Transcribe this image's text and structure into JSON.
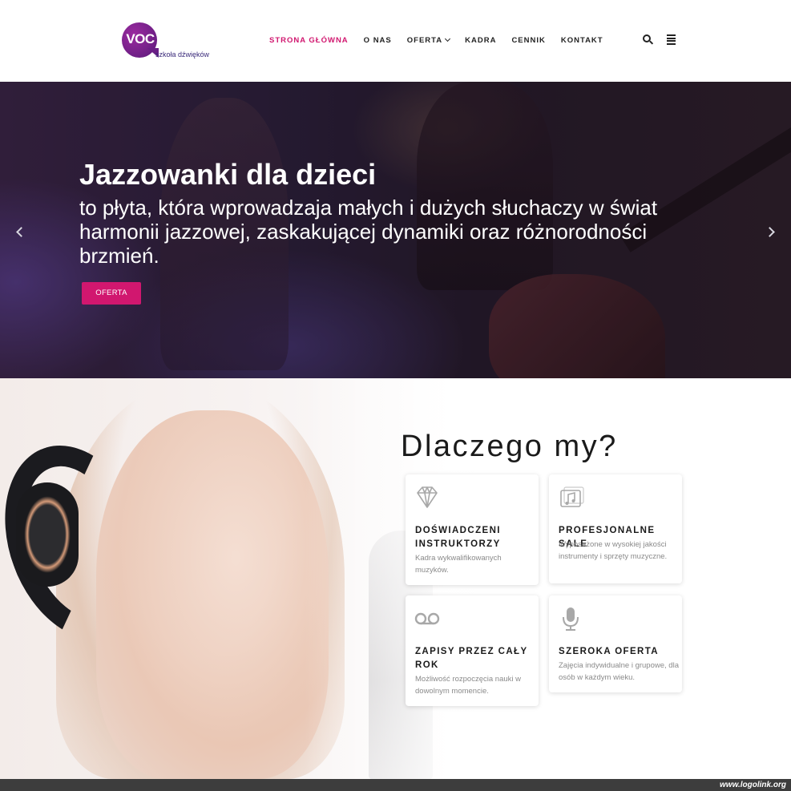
{
  "logo": {
    "mark": "VOC",
    "tagline": "szkoła dźwięków"
  },
  "nav": {
    "items": [
      {
        "label": "STRONA GŁÓWNA",
        "active": true
      },
      {
        "label": "O NAS"
      },
      {
        "label": "OFERTA",
        "has_dropdown": true
      },
      {
        "label": "KADRA"
      },
      {
        "label": "CENNIK"
      },
      {
        "label": "KONTAKT"
      }
    ],
    "icons": [
      "search-icon",
      "menu-icon"
    ]
  },
  "hero": {
    "title": "Jazzowanki dla dzieci",
    "text": "to płyta, która wprowadzaja małych i dużych słuchaczy w świat harmonii jazzowej, zaskakującej dynamiki oraz różnorodności brzmień.",
    "button": "OFERTA",
    "arrows": [
      "chevron-left-icon",
      "chevron-right-icon"
    ]
  },
  "why": {
    "title": "Dlaczego my?",
    "cards": [
      {
        "icon": "diamond-icon",
        "title": "DOŚWIADCZENI INSTRUKTORZY",
        "text": "Kadra wykwalifikowanych muzyków."
      },
      {
        "icon": "music-library-icon",
        "title": "PROFESJONALNE SALE",
        "text": "Wyposażone w wysokiej jakości instrumenty i sprzęty muzyczne."
      },
      {
        "icon": "voicemail-icon",
        "title": "ZAPISY PRZEZ CAŁY ROK",
        "text": "Możliwość rozpoczęcia nauki w dowolnym momencie."
      },
      {
        "icon": "microphone-icon",
        "title": "SZEROKA OFERTA",
        "text": "Zajęcia indywidualne i grupowe, dla osób w każdym wieku."
      }
    ]
  },
  "footer": {
    "watermark": "www.logolink.org"
  },
  "colors": {
    "accent": "#d1176f",
    "logo": "#7a1f8f",
    "dark_footer": "#3d3d3d"
  }
}
